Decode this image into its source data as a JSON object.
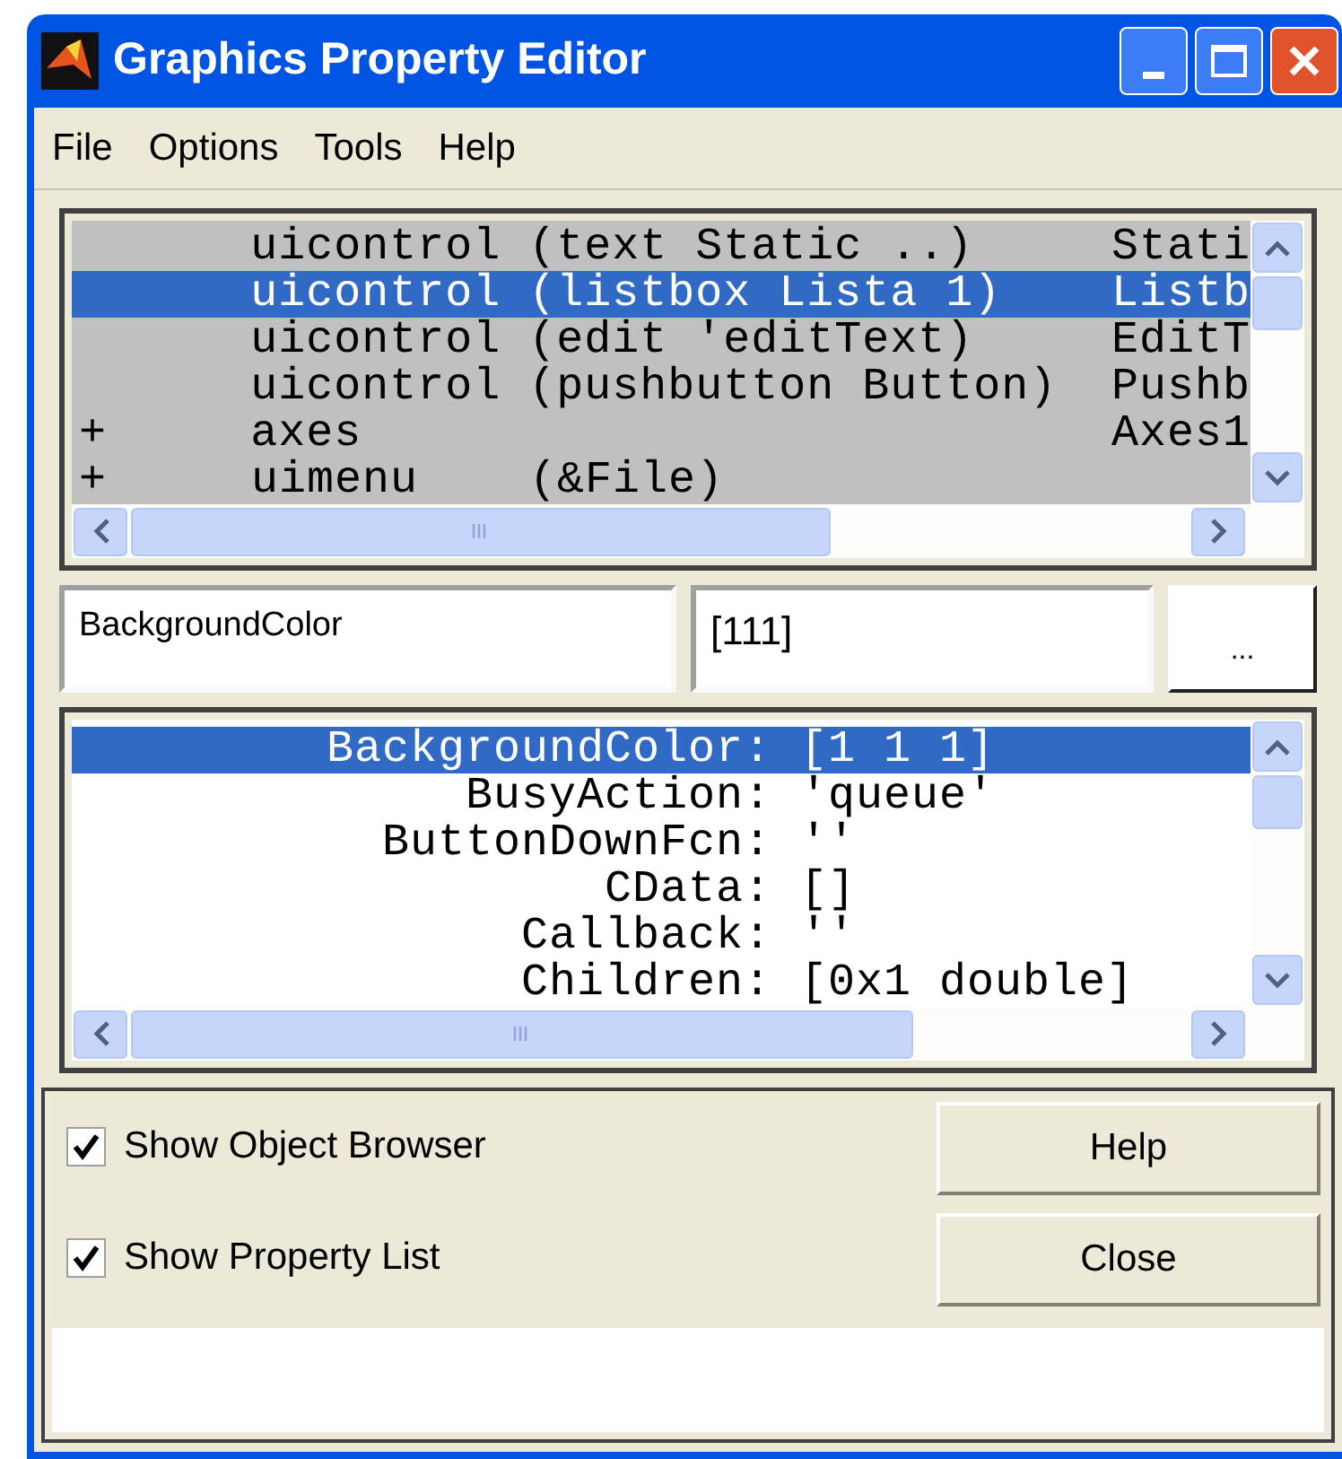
{
  "window": {
    "title": "Graphics Property Editor"
  },
  "menu": [
    {
      "label": "File"
    },
    {
      "label": "Options"
    },
    {
      "label": "Tools"
    },
    {
      "label": "Help"
    }
  ],
  "object_browser": {
    "rows": [
      {
        "expander": "",
        "label": "uicontrol (text Static ..)",
        "tag": "Stati",
        "selected": false
      },
      {
        "expander": "",
        "label": "uicontrol (listbox Lista 1)",
        "tag": "Listb",
        "selected": true
      },
      {
        "expander": "",
        "label": "uicontrol (edit 'editText)",
        "tag": "EditT",
        "selected": false
      },
      {
        "expander": "",
        "label": "uicontrol (pushbutton Button)",
        "tag": "Pushb",
        "selected": false
      },
      {
        "expander": "+",
        "label": "axes",
        "tag": "Axes1",
        "selected": false
      },
      {
        "expander": "+",
        "label": "uimenu    (&File)",
        "tag": "",
        "selected": false
      }
    ]
  },
  "property_name": {
    "value": "BackgroundColor"
  },
  "property_value": {
    "value": "[111]"
  },
  "browse_button": "...",
  "property_list": {
    "rows": [
      {
        "name": "BackgroundColor:",
        "value": "[1 1 1]",
        "selected": true
      },
      {
        "name": "BusyAction:",
        "value": "'queue'",
        "selected": false
      },
      {
        "name": "ButtonDownFcn:",
        "value": "''",
        "selected": false
      },
      {
        "name": "CData:",
        "value": "[]",
        "selected": false
      },
      {
        "name": "Callback:",
        "value": "''",
        "selected": false
      },
      {
        "name": "Children:",
        "value": "[0x1 double]",
        "selected": false
      }
    ]
  },
  "options": [
    {
      "label": "Show Object Browser",
      "checked": true
    },
    {
      "label": "Show Property List",
      "checked": true
    }
  ],
  "buttons": [
    "Help",
    "Close"
  ]
}
